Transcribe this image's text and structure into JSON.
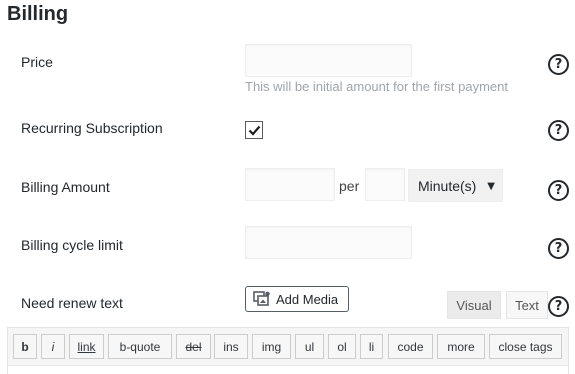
{
  "section": {
    "title": "Billing"
  },
  "fields": {
    "price": {
      "label": "Price",
      "value": "",
      "description": "This will be initial amount for the first payment"
    },
    "recurring": {
      "label": "Recurring Subscription",
      "checked": true
    },
    "billing_amount": {
      "label": "Billing Amount",
      "value": "",
      "per": "per",
      "interval_value": "",
      "unit": "Minute(s)"
    },
    "cycle_limit": {
      "label": "Billing cycle limit",
      "value": ""
    },
    "renew_text": {
      "label": "Need renew text"
    }
  },
  "help_glyph": "?",
  "editor": {
    "add_media": "Add Media",
    "tabs": {
      "visual": "Visual",
      "text": "Text"
    },
    "quicktags": [
      {
        "id": "b",
        "label": "b"
      },
      {
        "id": "i",
        "label": "i"
      },
      {
        "id": "link",
        "label": "link"
      },
      {
        "id": "block",
        "label": "b-quote"
      },
      {
        "id": "del",
        "label": "del"
      },
      {
        "id": "ins",
        "label": "ins"
      },
      {
        "id": "img",
        "label": "img"
      },
      {
        "id": "ul",
        "label": "ul"
      },
      {
        "id": "ol",
        "label": "ol"
      },
      {
        "id": "li",
        "label": "li"
      },
      {
        "id": "code",
        "label": "code"
      },
      {
        "id": "more",
        "label": "more"
      },
      {
        "id": "close",
        "label": "close tags"
      }
    ]
  },
  "colors": {
    "text": "#23282d",
    "muted": "#a0a5aa",
    "input_bg": "#fbfbfb",
    "border": "#e5e5e5"
  },
  "icons": {
    "help": "help-circle-icon",
    "media": "media-icon",
    "check": "checkmark-icon",
    "dropdown": "dropdown-arrow-icon"
  }
}
